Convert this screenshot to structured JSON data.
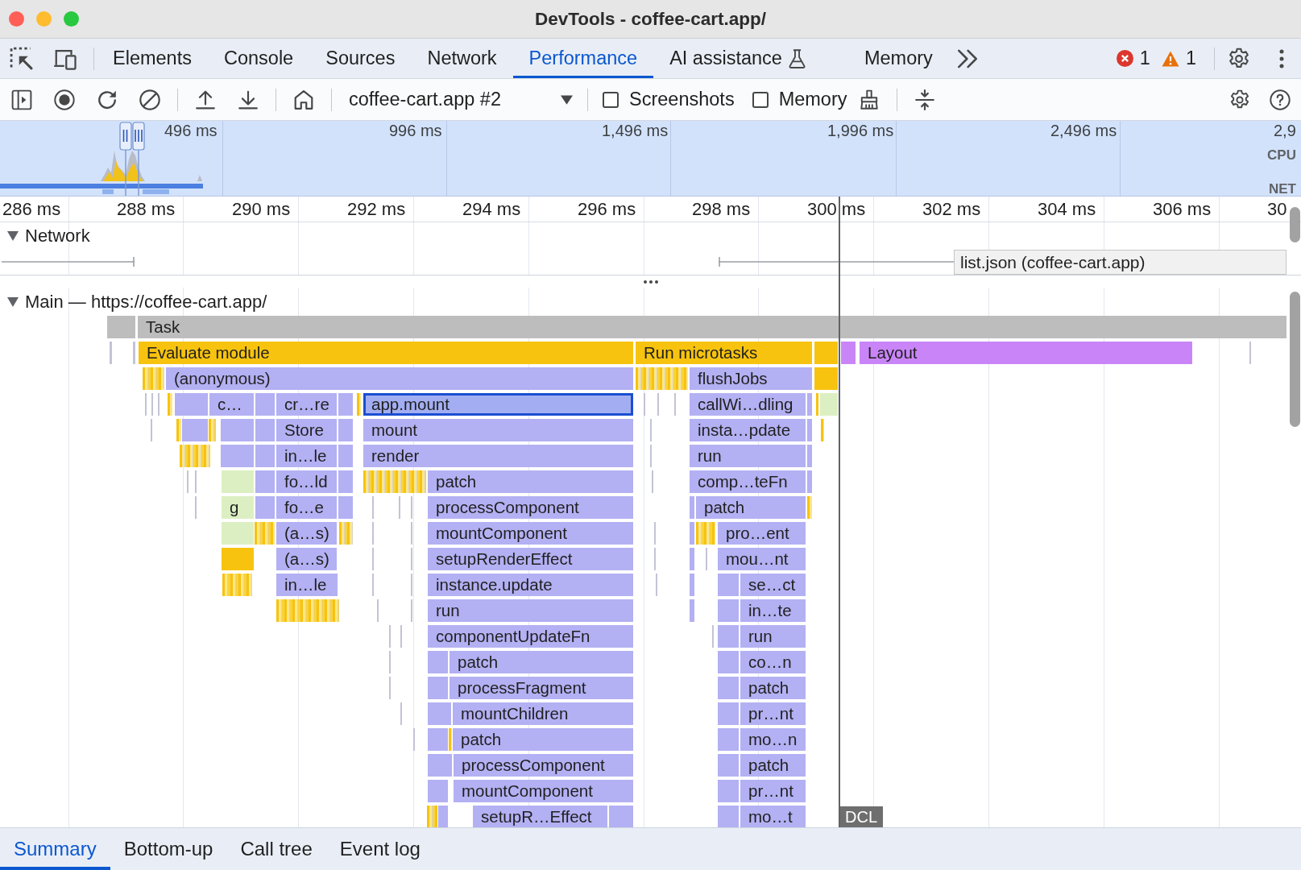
{
  "window": {
    "title": "DevTools - coffee-cart.app/"
  },
  "panel_tabs": [
    {
      "label": "Elements",
      "selected": false
    },
    {
      "label": "Console",
      "selected": false
    },
    {
      "label": "Sources",
      "selected": false
    },
    {
      "label": "Network",
      "selected": false
    },
    {
      "label": "Performance",
      "selected": true
    },
    {
      "label": "AI assistance",
      "selected": false,
      "kind": "experimental"
    },
    {
      "label": "Memory",
      "selected": false
    }
  ],
  "issue_counts": {
    "errors": "1",
    "warnings": "1"
  },
  "toolbar": {
    "recording": "coffee-cart.app #2",
    "options": [
      {
        "label": "Screenshots",
        "checked": false
      },
      {
        "label": "Memory",
        "checked": false
      }
    ]
  },
  "overview": {
    "time_labels": [
      "496 ms",
      "996 ms",
      "1,496 ms",
      "1,996 ms",
      "2,496 ms",
      "2,9"
    ],
    "track_labels": [
      "CPU",
      "NET"
    ]
  },
  "ruler": {
    "ticks": [
      "286 ms",
      "288 ms",
      "290 ms",
      "292 ms",
      "294 ms",
      "296 ms",
      "298 ms",
      "300 ms",
      "302 ms",
      "304 ms",
      "306 ms",
      "30"
    ]
  },
  "network_track": {
    "title": "Network",
    "expanded": true,
    "requests": [
      {
        "kind": "whisker"
      },
      {
        "kind": "bar",
        "label": "list.json (coffee-cart.app)"
      }
    ]
  },
  "main_track": {
    "title": "Main — https://coffee-cart.app/",
    "expanded": true,
    "levels": [
      {
        "entries": [
          {
            "kind": "task",
            "selected": false
          },
          {
            "kind": "task",
            "label": "Task",
            "selected": false
          }
        ]
      },
      {
        "entries": [
          {
            "kind": "line",
            "selected": false
          },
          {
            "kind": "line",
            "selected": false
          },
          {
            "kind": "event",
            "label": "Evaluate module",
            "selected": false
          },
          {
            "kind": "event",
            "label": "Run microtasks",
            "selected": false
          },
          {
            "kind": "event",
            "selected": false
          },
          {
            "kind": "layout",
            "selected": false
          },
          {
            "kind": "layout",
            "label": "Layout",
            "selected": false
          },
          {
            "kind": "line",
            "selected": false
          }
        ]
      },
      {
        "entries": [
          {
            "kind": "stripes",
            "selected": false
          },
          {
            "kind": "call",
            "label": "(anonymous)",
            "selected": false
          },
          {
            "kind": "stripes",
            "selected": false
          },
          {
            "kind": "call",
            "label": "flushJobs",
            "selected": false
          },
          {
            "kind": "event",
            "selected": false
          }
        ]
      },
      {
        "entries": [
          {
            "kind": "line",
            "selected": false
          },
          {
            "kind": "line",
            "selected": false
          },
          {
            "kind": "line",
            "selected": false
          },
          {
            "kind": "stripes",
            "selected": false
          },
          {
            "kind": "call",
            "selected": false
          },
          {
            "kind": "call",
            "label": "c…",
            "selected": false
          },
          {
            "kind": "call",
            "selected": false
          },
          {
            "kind": "call",
            "label": "cr…re",
            "selected": false
          },
          {
            "kind": "call",
            "selected": false
          },
          {
            "kind": "stripes",
            "selected": false
          },
          {
            "kind": "call",
            "label": "app.mount",
            "selected": true
          },
          {
            "kind": "line",
            "selected": false
          },
          {
            "kind": "line",
            "selected": false
          },
          {
            "kind": "line",
            "selected": false
          },
          {
            "kind": "call",
            "label": "callWi…dling",
            "selected": false
          },
          {
            "kind": "call",
            "selected": false
          },
          {
            "kind": "stripes",
            "selected": false
          },
          {
            "kind": "call-alt",
            "selected": false
          }
        ]
      },
      {
        "entries": [
          {
            "kind": "line",
            "selected": false
          },
          {
            "kind": "stripes",
            "selected": false
          },
          {
            "kind": "call",
            "selected": false
          },
          {
            "kind": "stripes",
            "selected": false
          },
          {
            "kind": "call",
            "selected": false
          },
          {
            "kind": "call",
            "selected": false
          },
          {
            "kind": "call",
            "label": "Store",
            "selected": false
          },
          {
            "kind": "call",
            "selected": false
          },
          {
            "kind": "call",
            "label": "mount",
            "selected": false
          },
          {
            "kind": "line",
            "selected": false
          },
          {
            "kind": "call",
            "label": "insta…pdate",
            "selected": false
          },
          {
            "kind": "call",
            "selected": false
          },
          {
            "kind": "stripes",
            "selected": false
          }
        ]
      },
      {
        "entries": [
          {
            "kind": "stripes",
            "selected": false
          },
          {
            "kind": "call",
            "selected": false
          },
          {
            "kind": "call",
            "selected": false
          },
          {
            "kind": "call",
            "label": "in…le",
            "selected": false
          },
          {
            "kind": "call",
            "selected": false
          },
          {
            "kind": "call",
            "label": "render",
            "selected": false
          },
          {
            "kind": "line",
            "selected": false
          },
          {
            "kind": "call",
            "label": "run",
            "selected": false
          },
          {
            "kind": "call",
            "selected": false
          }
        ]
      },
      {
        "entries": [
          {
            "kind": "line",
            "selected": false
          },
          {
            "kind": "line",
            "selected": false
          },
          {
            "kind": "call-alt",
            "selected": false
          },
          {
            "kind": "call",
            "selected": false
          },
          {
            "kind": "call",
            "label": "fo…ld",
            "selected": false
          },
          {
            "kind": "call",
            "selected": false
          },
          {
            "kind": "stripes",
            "selected": false
          },
          {
            "kind": "call",
            "label": "patch",
            "selected": false
          },
          {
            "kind": "line",
            "selected": false
          },
          {
            "kind": "call",
            "label": "comp…teFn",
            "selected": false
          },
          {
            "kind": "call",
            "selected": false
          }
        ]
      },
      {
        "entries": [
          {
            "kind": "line",
            "selected": false
          },
          {
            "kind": "call-alt",
            "label": "g",
            "selected": false
          },
          {
            "kind": "call",
            "selected": false
          },
          {
            "kind": "call",
            "label": "fo…e",
            "selected": false
          },
          {
            "kind": "call",
            "selected": false
          },
          {
            "kind": "line",
            "selected": false
          },
          {
            "kind": "line",
            "selected": false
          },
          {
            "kind": "line",
            "selected": false
          },
          {
            "kind": "call",
            "label": "processComponent",
            "selected": false
          },
          {
            "kind": "call",
            "selected": false
          },
          {
            "kind": "call",
            "label": "patch",
            "selected": false
          },
          {
            "kind": "stripes",
            "selected": false
          }
        ]
      },
      {
        "entries": [
          {
            "kind": "call-alt",
            "selected": false
          },
          {
            "kind": "stripes",
            "selected": false
          },
          {
            "kind": "call",
            "label": "(a…s)",
            "selected": false
          },
          {
            "kind": "stripes",
            "selected": false
          },
          {
            "kind": "line",
            "selected": false
          },
          {
            "kind": "line",
            "selected": false
          },
          {
            "kind": "call",
            "label": "mountComponent",
            "selected": false
          },
          {
            "kind": "line",
            "selected": false
          },
          {
            "kind": "call",
            "selected": false
          },
          {
            "kind": "stripes",
            "selected": false
          },
          {
            "kind": "call",
            "label": "pro…ent",
            "selected": false
          }
        ]
      },
      {
        "entries": [
          {
            "kind": "event",
            "selected": false
          },
          {
            "kind": "call",
            "label": "(a…s)",
            "selected": false
          },
          {
            "kind": "line",
            "selected": false
          },
          {
            "kind": "line",
            "selected": false
          },
          {
            "kind": "call",
            "label": "setupRenderEffect",
            "selected": false
          },
          {
            "kind": "line",
            "selected": false
          },
          {
            "kind": "call",
            "selected": false
          },
          {
            "kind": "line",
            "selected": false
          },
          {
            "kind": "call",
            "label": "mou…nt",
            "selected": false
          }
        ]
      },
      {
        "entries": [
          {
            "kind": "stripes",
            "selected": false
          },
          {
            "kind": "call",
            "label": "in…le",
            "selected": false
          },
          {
            "kind": "line",
            "selected": false
          },
          {
            "kind": "line",
            "selected": false
          },
          {
            "kind": "call",
            "label": "instance.update",
            "selected": false
          },
          {
            "kind": "line",
            "selected": false
          },
          {
            "kind": "call",
            "selected": false
          },
          {
            "kind": "call",
            "selected": false
          },
          {
            "kind": "call",
            "label": "se…ct",
            "selected": false
          }
        ]
      },
      {
        "entries": [
          {
            "kind": "stripes",
            "selected": false
          },
          {
            "kind": "line",
            "selected": false
          },
          {
            "kind": "line",
            "selected": false
          },
          {
            "kind": "call",
            "label": "run",
            "selected": false
          },
          {
            "kind": "call",
            "selected": false
          },
          {
            "kind": "call",
            "selected": false
          },
          {
            "kind": "call",
            "label": "in…te",
            "selected": false
          }
        ]
      },
      {
        "entries": [
          {
            "kind": "line",
            "selected": false
          },
          {
            "kind": "line",
            "selected": false
          },
          {
            "kind": "call",
            "label": "componentUpdateFn",
            "selected": false
          },
          {
            "kind": "line",
            "selected": false
          },
          {
            "kind": "call",
            "selected": false
          },
          {
            "kind": "call",
            "label": "run",
            "selected": false
          }
        ]
      },
      {
        "entries": [
          {
            "kind": "line",
            "selected": false
          },
          {
            "kind": "call",
            "selected": false
          },
          {
            "kind": "call",
            "label": "patch",
            "selected": false
          },
          {
            "kind": "call",
            "selected": false
          },
          {
            "kind": "call",
            "label": "co…n",
            "selected": false
          }
        ]
      },
      {
        "entries": [
          {
            "kind": "line",
            "selected": false
          },
          {
            "kind": "call",
            "selected": false
          },
          {
            "kind": "call",
            "label": "processFragment",
            "selected": false
          },
          {
            "kind": "call",
            "selected": false
          },
          {
            "kind": "call",
            "label": "patch",
            "selected": false
          }
        ]
      },
      {
        "entries": [
          {
            "kind": "line",
            "selected": false
          },
          {
            "kind": "call",
            "selected": false
          },
          {
            "kind": "call",
            "label": "mountChildren",
            "selected": false
          },
          {
            "kind": "call",
            "selected": false
          },
          {
            "kind": "call",
            "label": "pr…nt",
            "selected": false
          }
        ]
      },
      {
        "entries": [
          {
            "kind": "line",
            "selected": false
          },
          {
            "kind": "call",
            "selected": false
          },
          {
            "kind": "stripes",
            "selected": false
          },
          {
            "kind": "call",
            "label": "patch",
            "selected": false
          },
          {
            "kind": "call",
            "selected": false
          },
          {
            "kind": "call",
            "label": "mo…n",
            "selected": false
          }
        ]
      },
      {
        "entries": [
          {
            "kind": "call",
            "selected": false
          },
          {
            "kind": "call",
            "label": "processComponent",
            "selected": false
          },
          {
            "kind": "call",
            "selected": false
          },
          {
            "kind": "call",
            "label": "patch",
            "selected": false
          }
        ]
      },
      {
        "entries": [
          {
            "kind": "call",
            "selected": false
          },
          {
            "kind": "call",
            "label": "mountComponent",
            "selected": false
          },
          {
            "kind": "call",
            "selected": false
          },
          {
            "kind": "call",
            "label": "pr…nt",
            "selected": false
          }
        ]
      },
      {
        "entries": [
          {
            "kind": "stripes",
            "selected": false
          },
          {
            "kind": "call",
            "selected": false
          },
          {
            "kind": "call",
            "label": "setupR…Effect",
            "selected": false
          },
          {
            "kind": "call",
            "selected": false
          },
          {
            "kind": "call",
            "selected": false
          },
          {
            "kind": "call",
            "label": "mo…t",
            "selected": false
          }
        ]
      }
    ]
  },
  "markers": [
    {
      "label": "DCL"
    }
  ],
  "details_tabs": [
    {
      "label": "Summary",
      "selected": true
    },
    {
      "label": "Bottom-up",
      "selected": false
    },
    {
      "label": "Call tree",
      "selected": false
    },
    {
      "label": "Event log",
      "selected": false
    }
  ]
}
